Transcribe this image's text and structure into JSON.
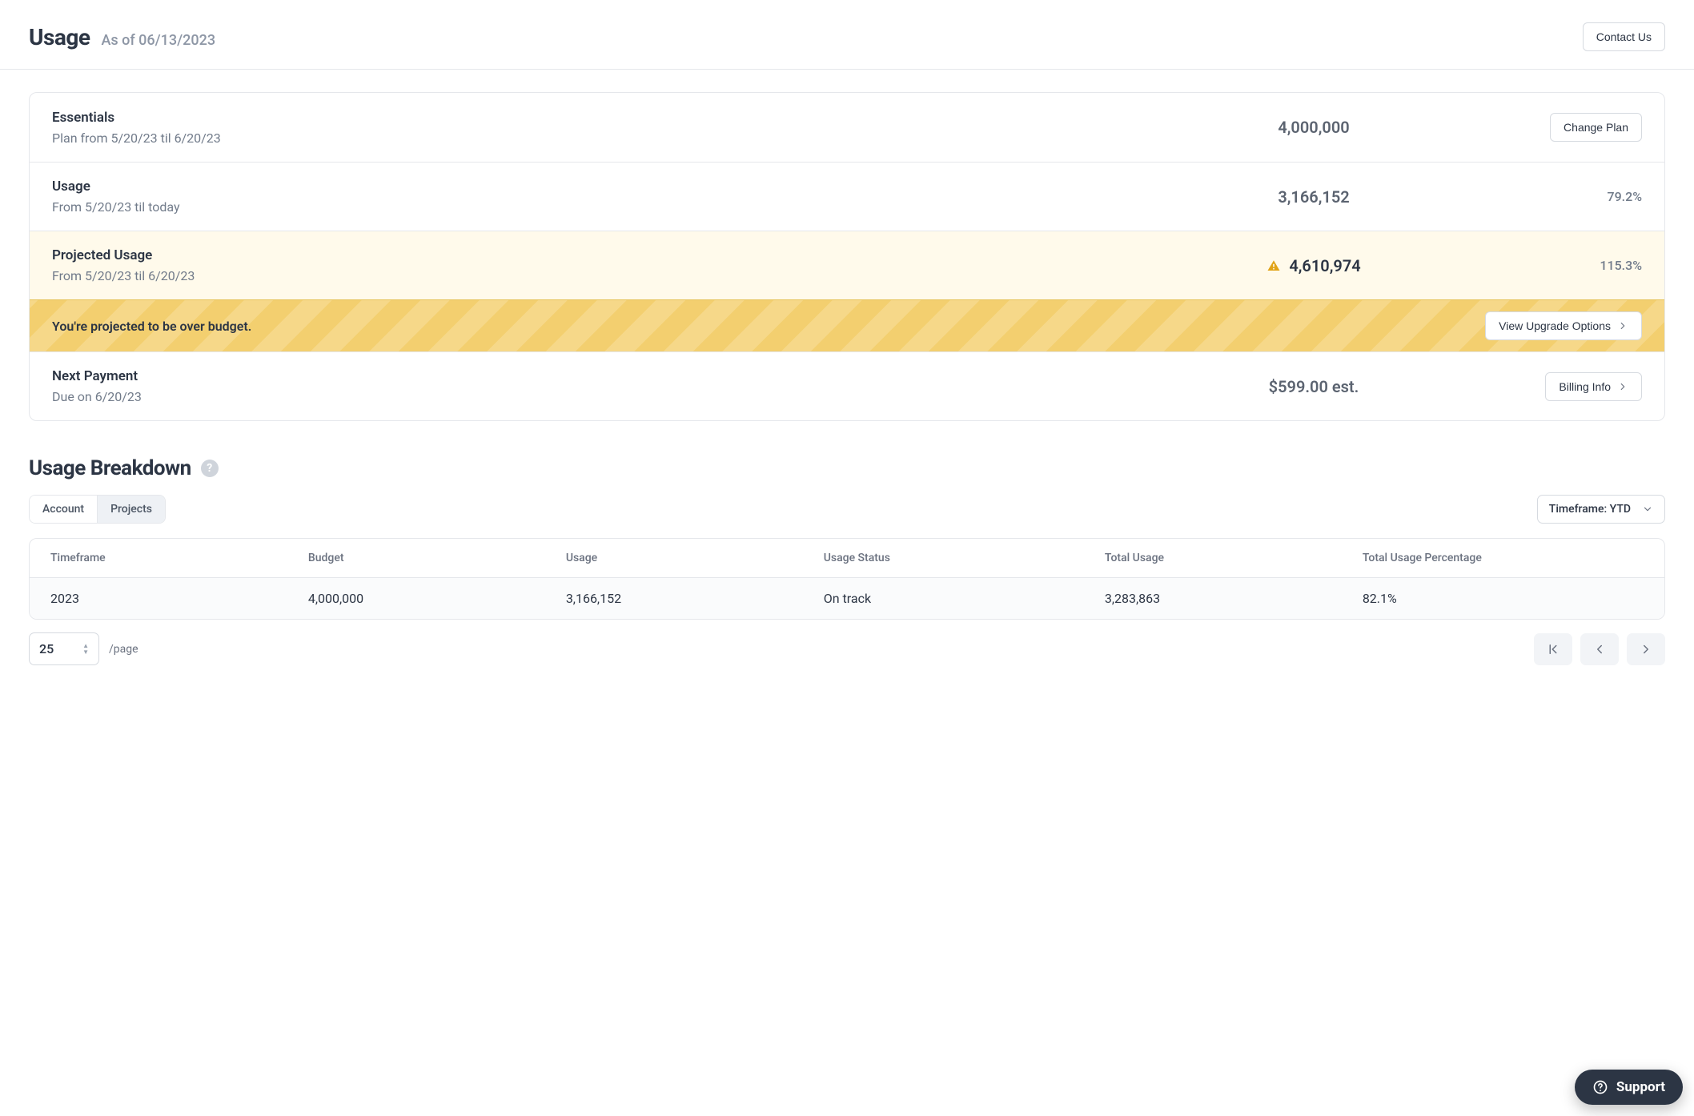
{
  "header": {
    "title": "Usage",
    "subtitle": "As of 06/13/2023",
    "contact_label": "Contact Us"
  },
  "plan_card": {
    "essentials": {
      "title": "Essentials",
      "sub": "Plan from 5/20/23 til 6/20/23",
      "value": "4,000,000",
      "button_label": "Change Plan"
    },
    "usage": {
      "title": "Usage",
      "sub": "From 5/20/23 til today",
      "value": "3,166,152",
      "percent": "79.2%"
    },
    "projected": {
      "title": "Projected Usage",
      "sub": "From 5/20/23 til 6/20/23",
      "value": "4,610,974",
      "percent": "115.3%"
    },
    "banner": {
      "text": "You're projected to be over budget.",
      "button_label": "View Upgrade Options"
    },
    "next_payment": {
      "title": "Next Payment",
      "sub": "Due on 6/20/23",
      "value": "$599.00 est.",
      "button_label": "Billing Info"
    }
  },
  "breakdown": {
    "section_title": "Usage Breakdown",
    "tabs": {
      "account": "Account",
      "projects": "Projects"
    },
    "timeframe_label": "Timeframe: YTD",
    "columns": {
      "timeframe": "Timeframe",
      "budget": "Budget",
      "usage": "Usage",
      "usage_status": "Usage Status",
      "total_usage": "Total Usage",
      "total_usage_pct": "Total Usage Percentage"
    },
    "rows": [
      {
        "timeframe": "2023",
        "budget": "4,000,000",
        "usage": "3,166,152",
        "usage_status": "On track",
        "total_usage": "3,283,863",
        "total_usage_pct": "82.1%"
      }
    ],
    "pager": {
      "size": "25",
      "label": "/page"
    }
  },
  "support_label": "Support"
}
